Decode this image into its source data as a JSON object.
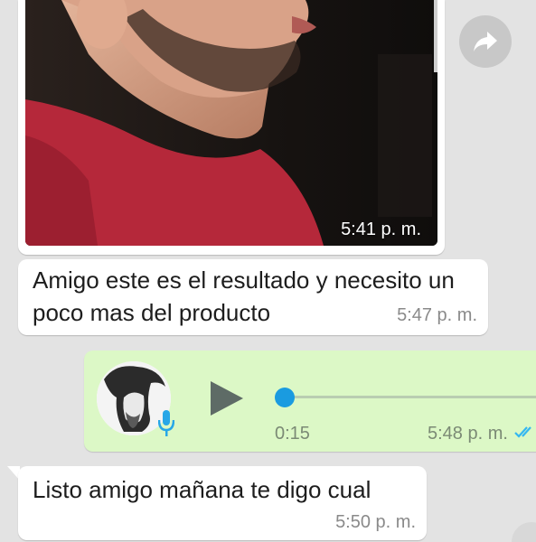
{
  "colors": {
    "chat_background": "#e3e3e3",
    "incoming_bubble": "#ffffff",
    "outgoing_bubble": "#dcf8c6",
    "read_ticks": "#34b7f1",
    "voice_progress": "#1a9be0"
  },
  "messages": [
    {
      "kind": "image",
      "direction": "incoming",
      "time": "5:41 p. m."
    },
    {
      "kind": "text",
      "direction": "incoming",
      "text": "Amigo este es el resultado y necesito un poco mas del producto",
      "time": "5:47 p. m."
    },
    {
      "kind": "voice",
      "direction": "outgoing",
      "duration": "0:15",
      "time": "5:48 p. m.",
      "progress": 0,
      "status_icon": "double-check-icon"
    },
    {
      "kind": "text",
      "direction": "incoming",
      "text": "Listo amigo mañana te digo cual",
      "time": "5:50 p. m."
    }
  ],
  "icons": {
    "forward": "forward-arrow-icon",
    "play": "play-icon",
    "mic": "microphone-icon"
  }
}
